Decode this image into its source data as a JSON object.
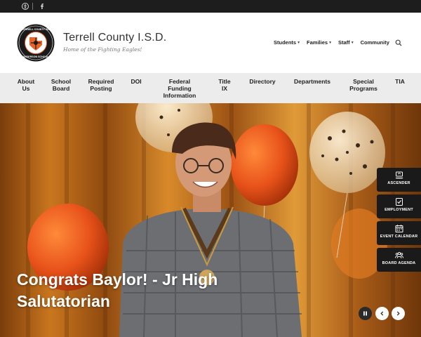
{
  "topbar": {
    "icons": [
      "web-accessibility-icon",
      "facebook-icon"
    ]
  },
  "header": {
    "logo": {
      "ring_text_top": "TERRELL COUNTY ISD",
      "ring_text_bottom": "SANDERSON SCHOOLS"
    },
    "title": "Terrell County I.S.D.",
    "tagline": "Home of the Fighting Eagles!",
    "top_nav": [
      {
        "label": "Students",
        "has_dropdown": true
      },
      {
        "label": "Families",
        "has_dropdown": true
      },
      {
        "label": "Staff",
        "has_dropdown": true
      },
      {
        "label": "Community",
        "has_dropdown": false
      }
    ]
  },
  "main_nav": [
    {
      "line1": "About",
      "line2": "Us"
    },
    {
      "line1": "School",
      "line2": "Board"
    },
    {
      "line1": "Required",
      "line2": "Posting"
    },
    {
      "line1": "DOI",
      "line2": ""
    },
    {
      "line1": "Federal",
      "line2": "Funding",
      "line3": "Information"
    },
    {
      "line1": "Title",
      "line2": "IX"
    },
    {
      "line1": "Directory",
      "line2": ""
    },
    {
      "line1": "Departments",
      "line2": ""
    },
    {
      "line1": "Special",
      "line2": "Programs"
    },
    {
      "line1": "TIA",
      "line2": ""
    }
  ],
  "hero": {
    "caption_line1": "Congrats Baylor! - Jr High",
    "caption_line2": "Salutatorian"
  },
  "quick_links": [
    {
      "label": "ASCENDER",
      "icon": "ascender-icon"
    },
    {
      "label": "EMPLOYMENT",
      "icon": "employment-icon"
    },
    {
      "label": "EVENT CALENDAR",
      "icon": "calendar-icon"
    },
    {
      "label": "BOARD AGENDA",
      "icon": "board-agenda-icon"
    }
  ],
  "colors": {
    "topbar": "#1d1d1d",
    "nav_bg": "#ececec",
    "quicklink_bg": "#1a1a1a",
    "brand_orange": "#e8642a"
  }
}
